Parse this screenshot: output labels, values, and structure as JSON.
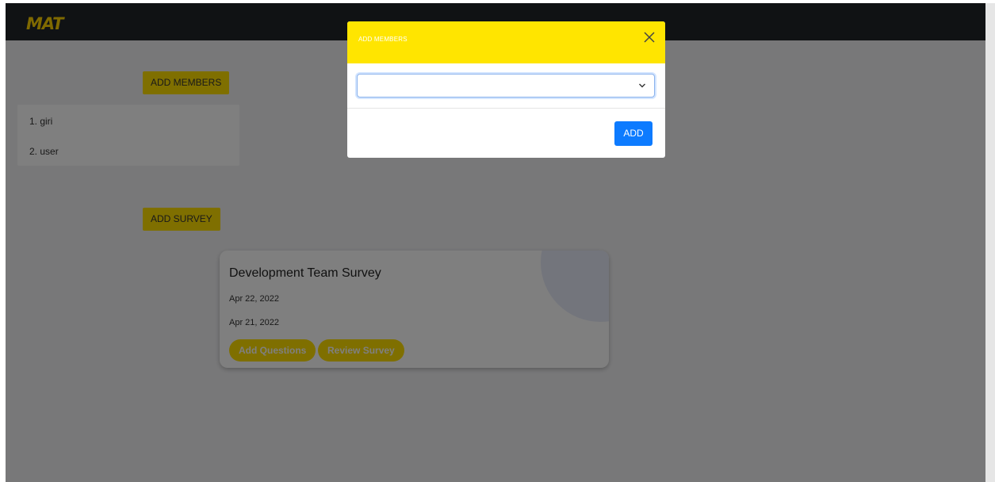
{
  "app": {
    "logo_text": "MAT"
  },
  "sidebar": {
    "add_members_label": "ADD MEMBERS",
    "members": [
      "1. giri",
      "2. user"
    ],
    "add_survey_label": "ADD SURVEY"
  },
  "survey_card": {
    "title": "Development Team Survey",
    "date_1": "Apr 22, 2022",
    "date_2": "Apr 21, 2022",
    "add_questions_label": "Add Questions",
    "review_survey_label": "Review Survey"
  },
  "modal": {
    "title": "ADD MEMBERS",
    "select_value": "",
    "add_label": "ADD",
    "close_icon": "close-icon"
  },
  "colors": {
    "topbar": "#212529",
    "accent_yellow": "#ffde00",
    "modal_header": "#ffe500",
    "primary_blue": "#0d7bff"
  }
}
